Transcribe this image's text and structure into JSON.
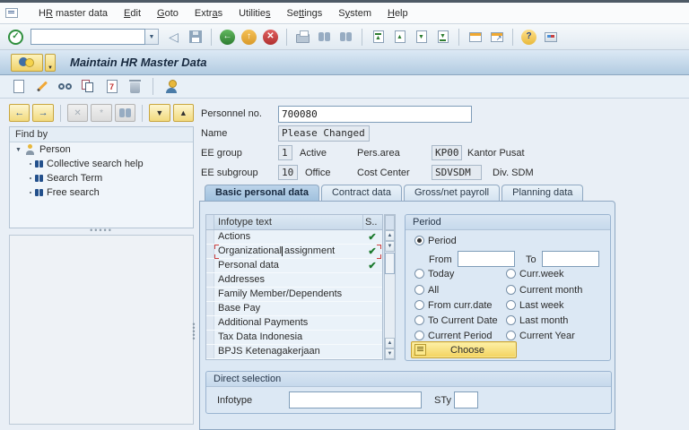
{
  "menu_bar": {
    "items": [
      {
        "pre": "H",
        "u": "R",
        "post": " master data"
      },
      {
        "pre": "",
        "u": "E",
        "post": "dit"
      },
      {
        "pre": "",
        "u": "G",
        "post": "oto"
      },
      {
        "pre": "Extr",
        "u": "a",
        "post": "s"
      },
      {
        "pre": "Utilitie",
        "u": "s",
        "post": ""
      },
      {
        "pre": "Se",
        "u": "tt",
        "post": "ings"
      },
      {
        "pre": "S",
        "u": "y",
        "post": "stem"
      },
      {
        "pre": "",
        "u": "H",
        "post": "elp"
      }
    ]
  },
  "standard_toolbar": {
    "command_value": ""
  },
  "title_bar": {
    "title": "Maintain HR Master Data"
  },
  "sidebar": {
    "header": "Find by",
    "tree_root": "Person",
    "tree_items": [
      "Collective search help",
      "Search Term",
      "Free search"
    ]
  },
  "form": {
    "personnel_no_label": "Personnel no.",
    "personnel_no_value": "700080",
    "name_label": "Name",
    "name_value": "Please Changed",
    "ee_group_label": "EE group",
    "ee_group_value": "1",
    "ee_group_text": "Active",
    "pers_area_label": "Pers.area",
    "pers_area_value": "KP00",
    "pers_area_text": "Kantor Pusat",
    "ee_subgroup_label": "EE subgroup",
    "ee_subgroup_value": "10",
    "ee_subgroup_text": "Office",
    "cost_center_label": "Cost Center",
    "cost_center_value": "SDVSDM",
    "cost_center_text": "Div. SDM"
  },
  "tabs": [
    {
      "label": "Basic personal data",
      "active": true
    },
    {
      "label": "Contract data",
      "active": false
    },
    {
      "label": "Gross/net payroll",
      "active": false
    },
    {
      "label": "Planning data",
      "active": false
    }
  ],
  "infotype_table": {
    "col_text": "Infotype text",
    "col_status": "S..",
    "rows": [
      {
        "text": "Actions",
        "checked": true,
        "selected": false
      },
      {
        "text": "Organizational assignment",
        "checked": true,
        "selected": true
      },
      {
        "text": "Personal data",
        "checked": true,
        "selected": false
      },
      {
        "text": "Addresses",
        "checked": false,
        "selected": false
      },
      {
        "text": "Family Member/Dependents",
        "checked": false,
        "selected": false
      },
      {
        "text": "Base Pay",
        "checked": false,
        "selected": false
      },
      {
        "text": "Additional Payments",
        "checked": false,
        "selected": false
      },
      {
        "text": "Tax Data Indonesia",
        "checked": false,
        "selected": false
      },
      {
        "text": "BPJS Ketenagakerjaan",
        "checked": false,
        "selected": false
      }
    ]
  },
  "period": {
    "title": "Period",
    "selected_option": "Period",
    "radio_period_label": "Period",
    "from_label": "From",
    "from_value": "",
    "to_label": "To",
    "to_value": "",
    "options_left": [
      "Today",
      "All",
      "From curr.date",
      "To Current Date",
      "Current Period"
    ],
    "options_right": [
      "Curr.week",
      "Current month",
      "Last week",
      "Last month",
      "Current Year"
    ],
    "choose_label": "Choose"
  },
  "direct_selection": {
    "title": "Direct selection",
    "infotype_label": "Infotype",
    "infotype_value": "",
    "sty_label": "STy",
    "sty_value": ""
  }
}
